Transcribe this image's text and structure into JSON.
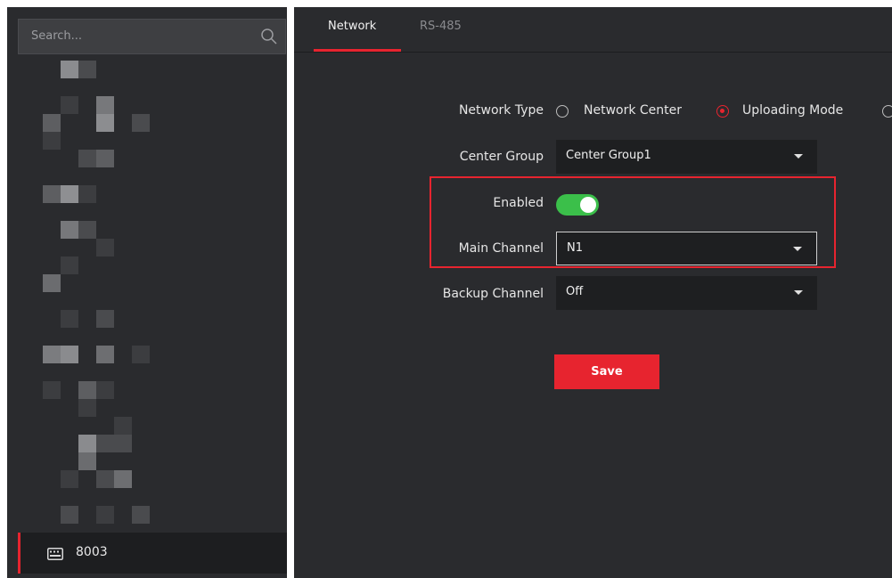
{
  "search": {
    "placeholder": "Search..."
  },
  "device_tree": {
    "selected_device": {
      "label": "8003",
      "icon": "device-keyboard-icon"
    }
  },
  "tabs": [
    {
      "label": "Network",
      "active": true
    },
    {
      "label": "RS-485",
      "active": false
    }
  ],
  "form": {
    "network_type": {
      "label": "Network Type",
      "options": [
        {
          "label": "Network Center",
          "selected": false
        },
        {
          "label": "Uploading Mode",
          "selected": true
        }
      ]
    },
    "center_group": {
      "label": "Center Group",
      "value": "Center Group1"
    },
    "enabled": {
      "label": "Enabled",
      "value": true
    },
    "main_channel": {
      "label": "Main Channel",
      "value": "N1"
    },
    "backup_channel": {
      "label": "Backup Channel",
      "value": "Off"
    },
    "save_label": "Save"
  },
  "colors": {
    "accent": "#e7242f",
    "toggle_on": "#3bbf4a",
    "panel_bg": "#2a2b2e"
  }
}
